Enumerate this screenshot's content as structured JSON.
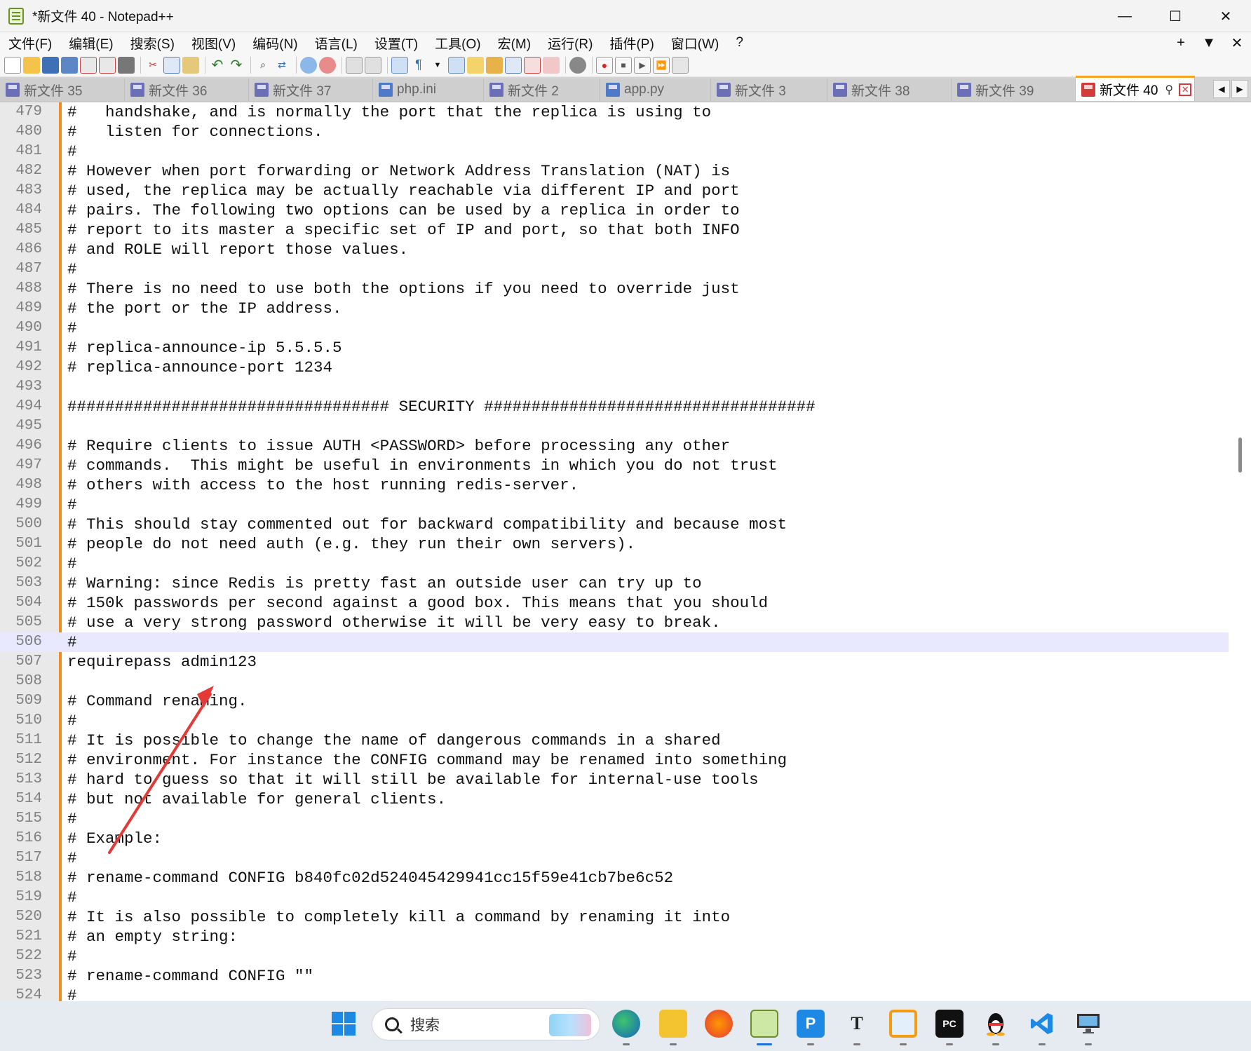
{
  "window": {
    "title": "*新文件 40 - Notepad++"
  },
  "menu": {
    "items": [
      "文件(F)",
      "编辑(E)",
      "搜索(S)",
      "视图(V)",
      "编码(N)",
      "语言(L)",
      "设置(T)",
      "工具(O)",
      "宏(M)",
      "运行(R)",
      "插件(P)",
      "窗口(W)",
      "?"
    ],
    "right": [
      "+",
      "▼",
      "✕"
    ]
  },
  "tabs": [
    {
      "label": "新文件 35",
      "icon": "disk-icon"
    },
    {
      "label": "新文件 36",
      "icon": "disk-icon"
    },
    {
      "label": "新文件 37",
      "icon": "disk-icon"
    },
    {
      "label": "php.ini",
      "icon": "disk-icon"
    },
    {
      "label": "新文件 2",
      "icon": "disk-icon"
    },
    {
      "label": "app.py",
      "icon": "disk-icon"
    },
    {
      "label": "新文件 3",
      "icon": "disk-icon"
    },
    {
      "label": "新文件 38",
      "icon": "disk-icon"
    },
    {
      "label": "新文件 39",
      "icon": "disk-icon"
    },
    {
      "label": "新文件 40",
      "icon": "unsaved-disk-icon",
      "active": true
    }
  ],
  "editor": {
    "current_line": 506,
    "lines": [
      {
        "n": "479",
        "text": "#   handshake, and is normally the port that the replica is using to"
      },
      {
        "n": "480",
        "text": "#   listen for connections."
      },
      {
        "n": "481",
        "text": "#"
      },
      {
        "n": "482",
        "text": "# However when port forwarding or Network Address Translation (NAT) is"
      },
      {
        "n": "483",
        "text": "# used, the replica may be actually reachable via different IP and port"
      },
      {
        "n": "484",
        "text": "# pairs. The following two options can be used by a replica in order to"
      },
      {
        "n": "485",
        "text": "# report to its master a specific set of IP and port, so that both INFO"
      },
      {
        "n": "486",
        "text": "# and ROLE will report those values."
      },
      {
        "n": "487",
        "text": "#"
      },
      {
        "n": "488",
        "text": "# There is no need to use both the options if you need to override just"
      },
      {
        "n": "489",
        "text": "# the port or the IP address."
      },
      {
        "n": "490",
        "text": "#"
      },
      {
        "n": "491",
        "text": "# replica-announce-ip 5.5.5.5"
      },
      {
        "n": "492",
        "text": "# replica-announce-port 1234"
      },
      {
        "n": "493",
        "text": ""
      },
      {
        "n": "494",
        "text": "################################## SECURITY ###################################"
      },
      {
        "n": "495",
        "text": ""
      },
      {
        "n": "496",
        "text": "# Require clients to issue AUTH <PASSWORD> before processing any other"
      },
      {
        "n": "497",
        "text": "# commands.  This might be useful in environments in which you do not trust"
      },
      {
        "n": "498",
        "text": "# others with access to the host running redis-server."
      },
      {
        "n": "499",
        "text": "#"
      },
      {
        "n": "500",
        "text": "# This should stay commented out for backward compatibility and because most"
      },
      {
        "n": "501",
        "text": "# people do not need auth (e.g. they run their own servers)."
      },
      {
        "n": "502",
        "text": "#"
      },
      {
        "n": "503",
        "text": "# Warning: since Redis is pretty fast an outside user can try up to"
      },
      {
        "n": "504",
        "text": "# 150k passwords per second against a good box. This means that you should"
      },
      {
        "n": "505",
        "text": "# use a very strong password otherwise it will be very easy to break."
      },
      {
        "n": "506",
        "text": "#"
      },
      {
        "n": "507",
        "text": "requirepass admin123"
      },
      {
        "n": "508",
        "text": ""
      },
      {
        "n": "509",
        "text": "# Command renaming."
      },
      {
        "n": "510",
        "text": "#"
      },
      {
        "n": "511",
        "text": "# It is possible to change the name of dangerous commands in a shared"
      },
      {
        "n": "512",
        "text": "# environment. For instance the CONFIG command may be renamed into something"
      },
      {
        "n": "513",
        "text": "# hard to guess so that it will still be available for internal-use tools"
      },
      {
        "n": "514",
        "text": "# but not available for general clients."
      },
      {
        "n": "515",
        "text": "#"
      },
      {
        "n": "516",
        "text": "# Example:"
      },
      {
        "n": "517",
        "text": "#"
      },
      {
        "n": "518",
        "text": "# rename-command CONFIG b840fc02d524045429941cc15f59e41cb7be6c52"
      },
      {
        "n": "519",
        "text": "#"
      },
      {
        "n": "520",
        "text": "# It is also possible to completely kill a command by renaming it into"
      },
      {
        "n": "521",
        "text": "# an empty string:"
      },
      {
        "n": "522",
        "text": "#"
      },
      {
        "n": "523",
        "text": "# rename-command CONFIG \"\""
      },
      {
        "n": "524",
        "text": "#"
      }
    ]
  },
  "taskbar": {
    "search_placeholder": "搜索",
    "apps": [
      {
        "name": "windows-start-icon",
        "glyph": ""
      },
      {
        "name": "edge-browser-icon",
        "glyph": ""
      },
      {
        "name": "file-explorer-icon",
        "glyph": ""
      },
      {
        "name": "firefox-icon",
        "glyph": ""
      },
      {
        "name": "notepadpp-icon",
        "glyph": ""
      },
      {
        "name": "pycharm-p-icon",
        "glyph": "P"
      },
      {
        "name": "typora-icon",
        "glyph": "T"
      },
      {
        "name": "vmware-icon",
        "glyph": ""
      },
      {
        "name": "pycharm-pc-icon",
        "glyph": "PC"
      },
      {
        "name": "qq-penguin-icon",
        "glyph": ""
      },
      {
        "name": "vscode-icon",
        "glyph": ""
      },
      {
        "name": "remote-desktop-icon",
        "glyph": ""
      }
    ]
  },
  "colors": {
    "change_bar": "#f28b24",
    "current_line": "#e8e8ff",
    "annotation_arrow": "#e53935"
  }
}
